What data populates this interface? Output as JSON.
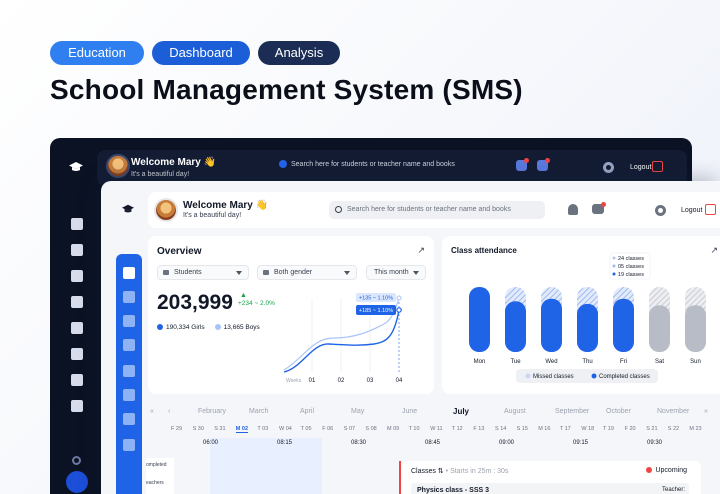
{
  "tags": [
    "Education",
    "Dashboard",
    "Analysis"
  ],
  "headline": "School Management System (SMS)",
  "header": {
    "welcome": "Welcome Mary 👋",
    "subtitle": "It's a beautiful day!",
    "search_placeholder": "Search here for students or teacher name and books",
    "logout": "Logout"
  },
  "overview": {
    "title": "Overview",
    "filter_type": "Students",
    "filter_gender": "Both gender",
    "filter_period": "This month",
    "total": "203,999",
    "delta": "+234 ~ 2.0%",
    "girls": "190,334 Girls",
    "boys": "13,665 Boys",
    "tooltip_top": "+135 ~ 1.10%",
    "tooltip_main": "+185 ~ 1.10%",
    "x_prefix": "Weeks",
    "weeks": [
      "01",
      "02",
      "03",
      "04"
    ]
  },
  "attendance": {
    "title": "Class attendance",
    "days": [
      "Mon",
      "Tue",
      "Wed",
      "Thu",
      "Fri",
      "Sat",
      "Sun"
    ],
    "tooltip": [
      "24 classes",
      "05 classes",
      "19 classes"
    ],
    "legend_missed": "Missed classes",
    "legend_completed": "Completed classes",
    "colors": {
      "completed": "#1f64e6",
      "missed": "#c9d8f6",
      "weekend": "#b8bcc6"
    }
  },
  "calendar": {
    "months": [
      "February",
      "March",
      "April",
      "May",
      "June",
      "July",
      "August",
      "September",
      "October",
      "November"
    ],
    "current_month": "July",
    "days": [
      "F 29",
      "S 30",
      "S 31",
      "M 02",
      "T 03",
      "W 04",
      "T 05",
      "F 06",
      "S 07",
      "S 08",
      "M 09",
      "T 10",
      "W 11",
      "T 12",
      "F 13",
      "S 14",
      "S 15",
      "M 16",
      "T 17",
      "W 18",
      "T 19",
      "F 20",
      "S 21",
      "S 22",
      "M 23"
    ],
    "today": "M 02",
    "times": [
      "06:00",
      "08:15",
      "08:30",
      "08:45",
      "09:00",
      "09:15",
      "09:30"
    ],
    "left_labels": [
      "ompleted",
      "eachers"
    ]
  },
  "classes": {
    "label": "Classes ⇅",
    "starts": "• Starts in 25m : 30s",
    "upcoming": "Upcoming",
    "current": "Physics class - SSS 3",
    "teacher": "Teacher:"
  }
}
